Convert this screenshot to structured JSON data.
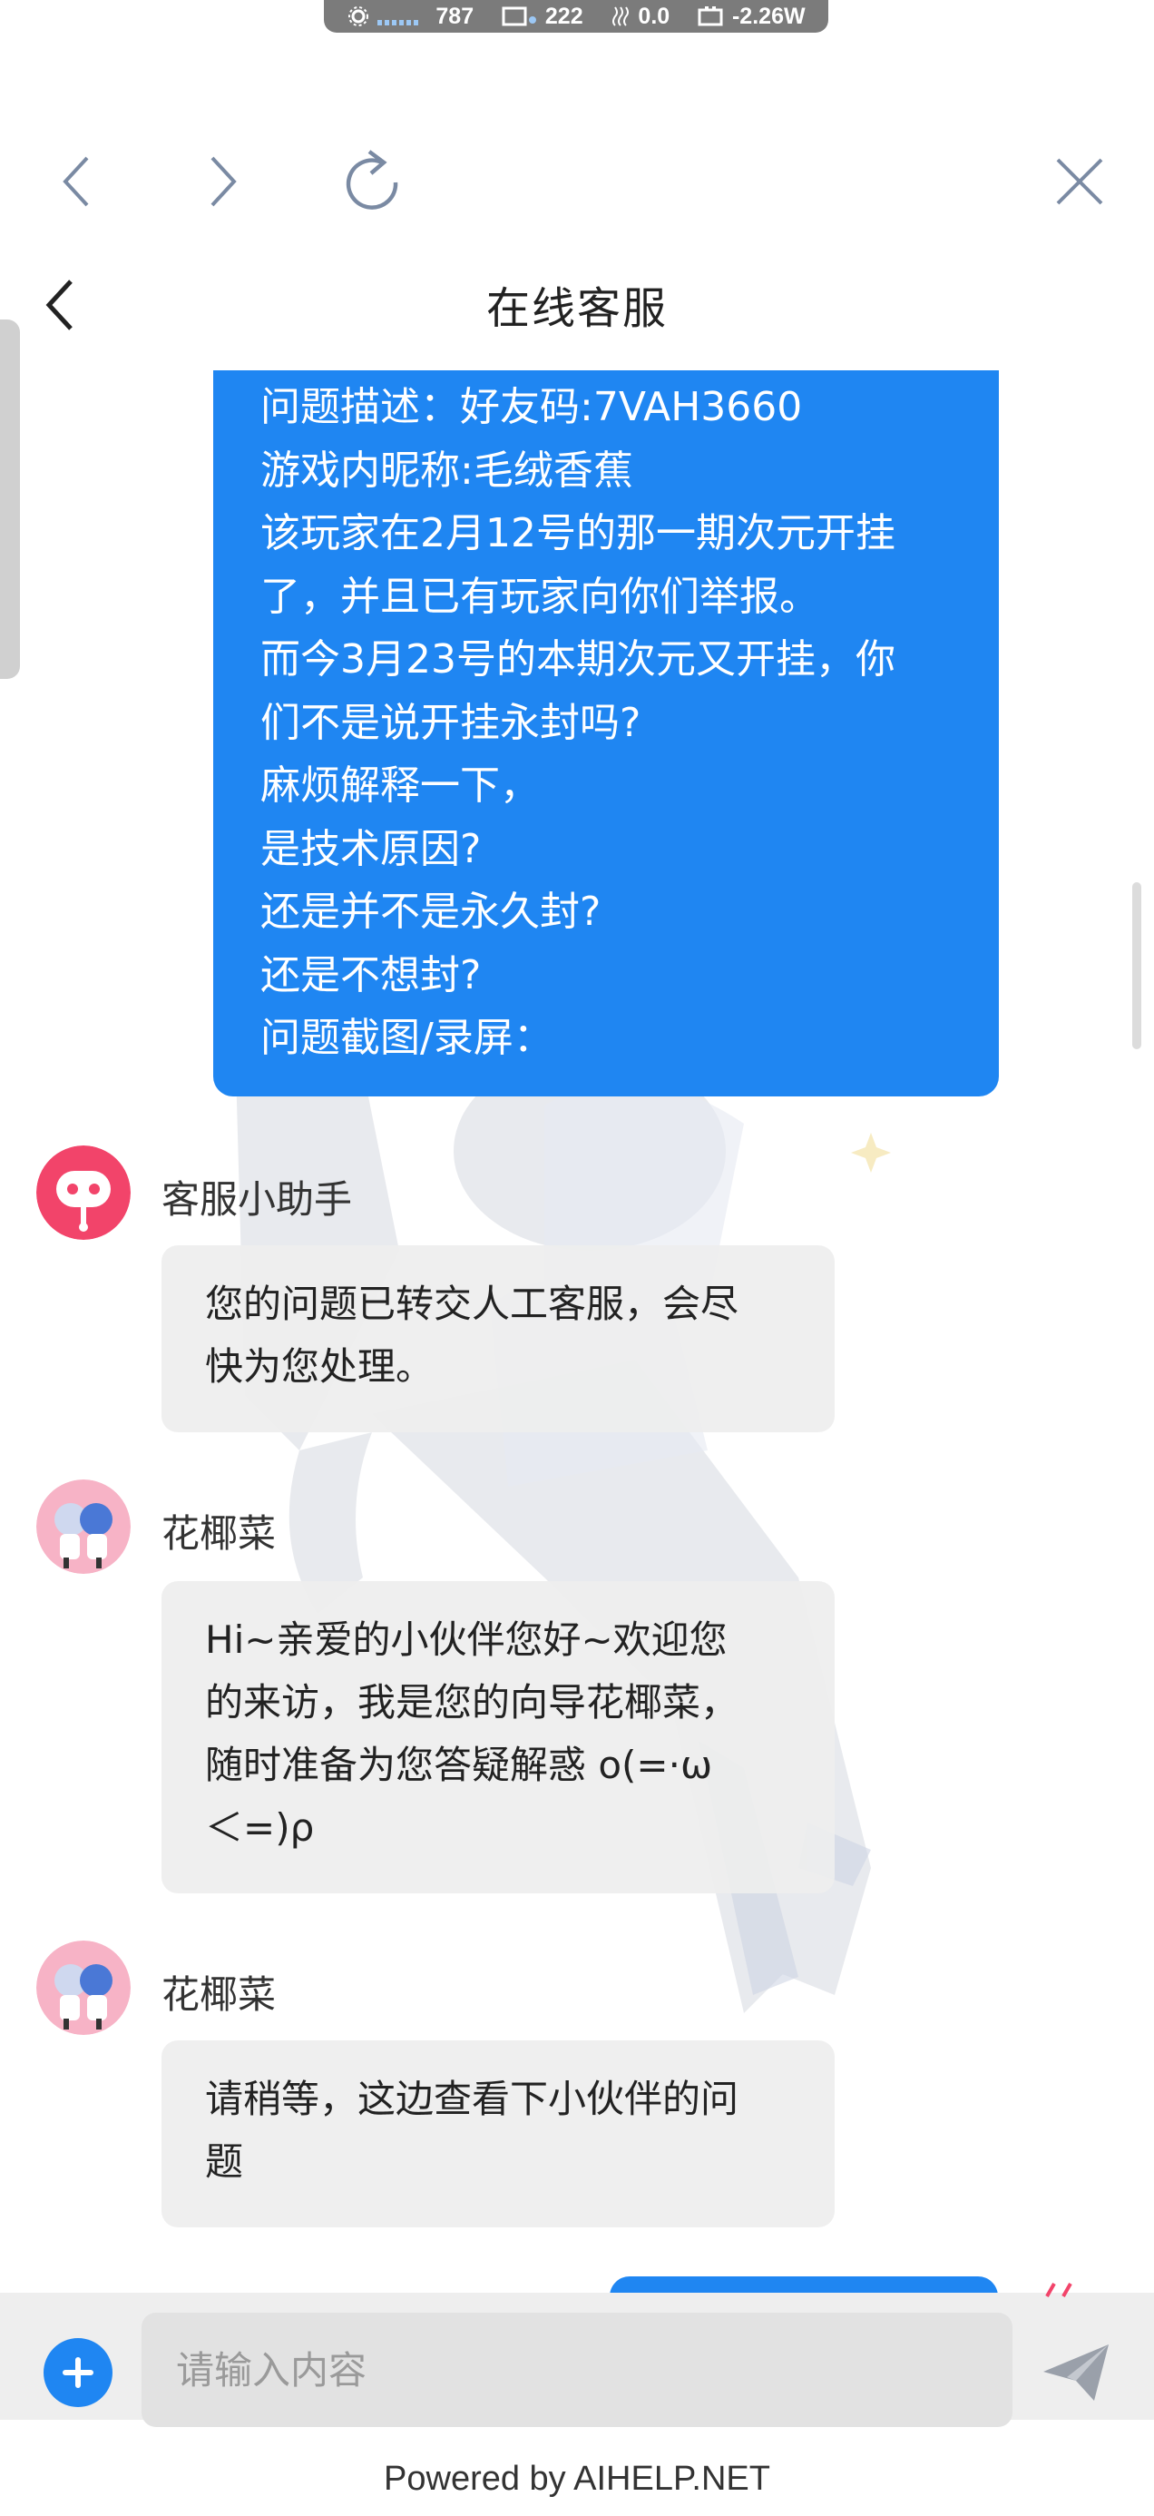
{
  "status_bar": {
    "net_speed": "787",
    "gpu": "222",
    "temp": "0.0",
    "power": "-2.26W"
  },
  "browser_nav": {
    "back_icon": "chevron-left-icon",
    "forward_icon": "chevron-right-icon",
    "refresh_icon": "refresh-icon",
    "close_icon": "close-icon"
  },
  "header": {
    "title": "在线客服"
  },
  "messages": {
    "user_message": {
      "lines": [
        "问题描述：好友码:7VAH3660",
        "游戏内昵称:毛绒香蕉",
        "该玩家在2月12号的那一期次元开挂",
        "了，并且已有玩家向你们举报。",
        "而今3月23号的本期次元又开挂，你",
        "们不是说开挂永封吗?",
        "麻烦解释一下，",
        "是技术原因?",
        "还是并不是永久封?",
        "还是不想封?",
        "问题截图/录屏："
      ]
    },
    "bot": {
      "sender": "客服小助手",
      "lines": [
        "您的问题已转交人工客服，会尽",
        "快为您处理。"
      ]
    },
    "agent1": {
      "sender": "花椰菜",
      "lines": [
        "Hi~亲爱的小伙伴您好~欢迎您",
        "的来访，我是您的向导花椰菜，",
        "随时准备为您答疑解惑 o(=·ω",
        "＜=)ρ"
      ]
    },
    "agent2": {
      "sender": "花椰菜",
      "lines": [
        "请稍等，这边查看下小伙伴的问",
        "题"
      ]
    }
  },
  "input": {
    "placeholder": "请输入内容"
  },
  "footer": {
    "text": "Powered by AIHELP.NET"
  },
  "colors": {
    "accent": "#1f86f2",
    "bot_avatar": "#f2446a"
  }
}
